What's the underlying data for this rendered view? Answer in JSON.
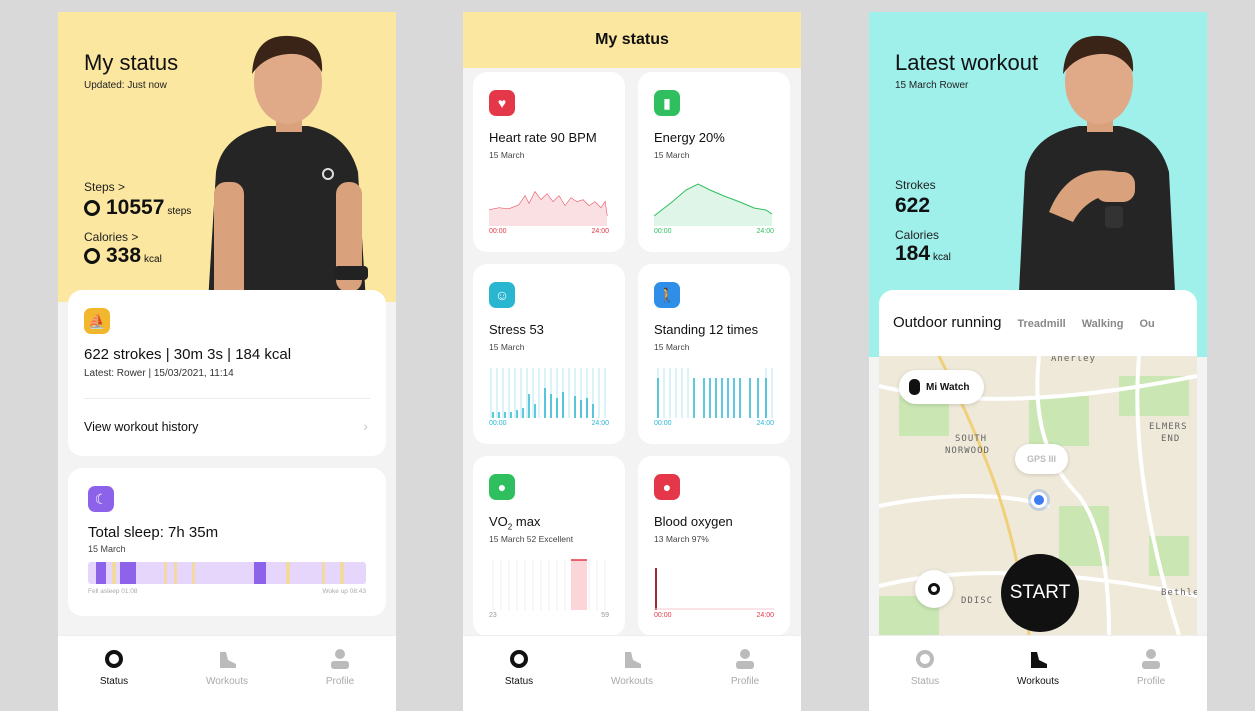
{
  "screen1": {
    "title": "My status",
    "updated": "Updated: Just now",
    "steps_label": "Steps >",
    "steps_value": "10557",
    "steps_unit": "steps",
    "calories_label": "Calories >",
    "calories_value": "338",
    "calories_unit": "kcal",
    "workout_summary": "622 strokes | 30m 3s | 184 kcal",
    "workout_latest": "Latest: Rower | 15/03/2021, 11:14",
    "workout_history": "View workout history",
    "sleep_title": "Total sleep: 7h 35m",
    "sleep_date": "15 March",
    "sleep_start": "Fell asleep 01:08",
    "sleep_end": "Woke up 08:43"
  },
  "screen2": {
    "title": "My status",
    "tiles": [
      {
        "title": "Heart rate 90 BPM",
        "date": "15 March",
        "from": "00:00",
        "to": "24:00",
        "color": "#e5374a"
      },
      {
        "title": "Energy 20%",
        "date": "15 March",
        "from": "00:00",
        "to": "24:00",
        "color": "#2fbf5f"
      },
      {
        "title": "Stress 53",
        "date": "15 March",
        "from": "00:00",
        "to": "24:00",
        "color": "#29b6d0"
      },
      {
        "title": "Standing 12 times",
        "date": "15 March",
        "from": "00:00",
        "to": "24:00",
        "color": "#2f8ee8"
      },
      {
        "title_main": "VO",
        "title_sub": "2",
        "title_rest": " max",
        "date": "15 March 52 Excellent",
        "from": "23",
        "to": "59",
        "color": "#2fbf5f"
      },
      {
        "title": "Blood oxygen",
        "date": "13 March 97%",
        "from": "00:00",
        "to": "24:00",
        "color": "#e5374a"
      }
    ]
  },
  "screen3": {
    "title": "Latest workout",
    "subtitle": "15 March Rower",
    "strokes_label": "Strokes",
    "strokes_value": "622",
    "calories_label": "Calories",
    "calories_value": "184",
    "calories_unit": "kcal",
    "sport_tabs": [
      "Outdoor running",
      "Treadmill",
      "Walking",
      "Ou"
    ],
    "device": "Mi Watch",
    "gps_label": "GPS III",
    "start": "START",
    "map_labels": {
      "anerley": "Anerley",
      "south_norwood": "SOUTH",
      "south_norwood2": "NORWOOD",
      "elmers": "ELMERS",
      "end": "END",
      "addisc": "DDISC",
      "bethle": "Bethle"
    }
  },
  "tabbar": {
    "status": "Status",
    "workouts": "Workouts",
    "profile": "Profile"
  },
  "colors": {
    "yellow_hero": "#fbe7a0",
    "cyan_hero": "#9fefea",
    "workout_badge": "#f2b72c",
    "sleep_badge": "#8c62ea"
  }
}
